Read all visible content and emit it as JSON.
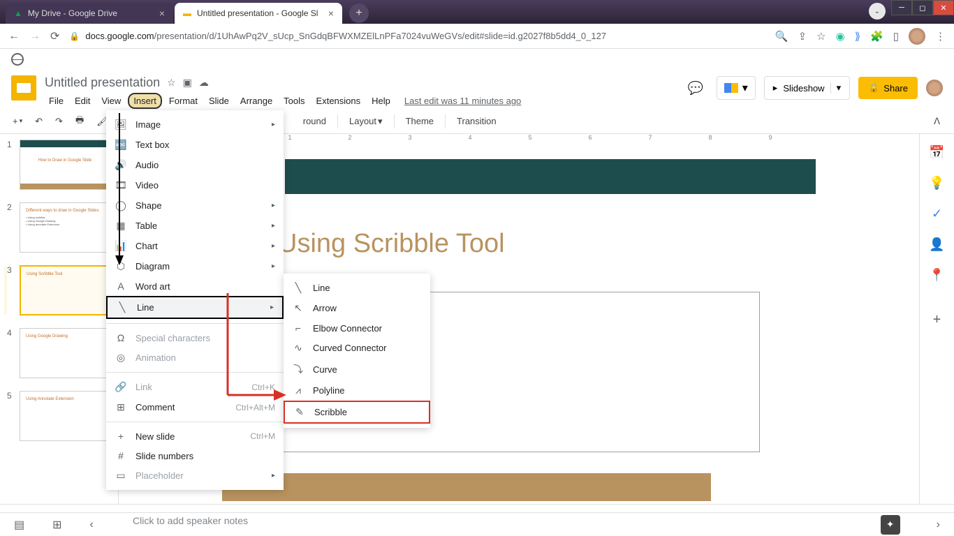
{
  "browser": {
    "tabs": [
      {
        "title": "My Drive - Google Drive",
        "active": false
      },
      {
        "title": "Untitled presentation - Google Sl",
        "active": true
      }
    ],
    "url_domain": "docs.google.com",
    "url_path": "/presentation/d/1UhAwPq2V_sUcp_SnGdqBFWXMZElLnPFa7024vuWeGVs/edit#slide=id.g2027f8b5dd4_0_127"
  },
  "doc": {
    "title": "Untitled presentation",
    "last_edit": "Last edit was 11 minutes ago"
  },
  "menubar": [
    "File",
    "Edit",
    "View",
    "Insert",
    "Format",
    "Slide",
    "Arrange",
    "Tools",
    "Extensions",
    "Help"
  ],
  "header_buttons": {
    "slideshow": "Slideshow",
    "share": "Share"
  },
  "toolbar": {
    "background": "round",
    "layout": "Layout",
    "theme": "Theme",
    "transition": "Transition"
  },
  "ruler": [
    "1",
    "",
    "1",
    "2",
    "3",
    "4",
    "5",
    "6",
    "7",
    "8",
    "9"
  ],
  "insert_menu": {
    "items": [
      {
        "label": "Image",
        "icon": "🖼",
        "arrow": true
      },
      {
        "label": "Text box",
        "icon": "🔤"
      },
      {
        "label": "Audio",
        "icon": "🔊"
      },
      {
        "label": "Video",
        "icon": "🎞"
      },
      {
        "label": "Shape",
        "icon": "◯",
        "arrow": true
      },
      {
        "label": "Table",
        "icon": "▦",
        "arrow": true
      },
      {
        "label": "Chart",
        "icon": "📊",
        "arrow": true
      },
      {
        "label": "Diagram",
        "icon": "⬡",
        "arrow": true
      },
      {
        "label": "Word art",
        "icon": "A"
      },
      {
        "label": "Line",
        "icon": "╲",
        "arrow": true,
        "highlighted": true
      }
    ],
    "group2": [
      {
        "label": "Special characters",
        "icon": "Ω",
        "disabled": true
      },
      {
        "label": "Animation",
        "icon": "◎",
        "disabled": true
      }
    ],
    "group3": [
      {
        "label": "Link",
        "icon": "🔗",
        "shortcut": "Ctrl+K",
        "disabled": true
      },
      {
        "label": "Comment",
        "icon": "⊞",
        "shortcut": "Ctrl+Alt+M"
      }
    ],
    "group4": [
      {
        "label": "New slide",
        "icon": "+",
        "shortcut": "Ctrl+M"
      },
      {
        "label": "Slide numbers",
        "icon": "#"
      },
      {
        "label": "Placeholder",
        "icon": "▭",
        "arrow": true,
        "disabled": true
      }
    ]
  },
  "line_submenu": [
    {
      "label": "Line",
      "icon": "╲"
    },
    {
      "label": "Arrow",
      "icon": "↖"
    },
    {
      "label": "Elbow Connector",
      "icon": "⌐"
    },
    {
      "label": "Curved Connector",
      "icon": "∿"
    },
    {
      "label": "Curve",
      "icon": "⤵"
    },
    {
      "label": "Polyline",
      "icon": "⩘"
    },
    {
      "label": "Scribble",
      "icon": "✎",
      "boxed": true
    }
  ],
  "thumbnails": [
    {
      "title": "How to Draw in Google Slide"
    },
    {
      "title": "Different ways to draw in Google Slides"
    },
    {
      "title": "Using Scribble Tool",
      "active": true
    },
    {
      "title": "Using Google Drawing"
    },
    {
      "title": "Using Annotate Extension"
    }
  ],
  "slide": {
    "title": "Using Scribble Tool"
  },
  "notes_placeholder": "Click to add speaker notes"
}
